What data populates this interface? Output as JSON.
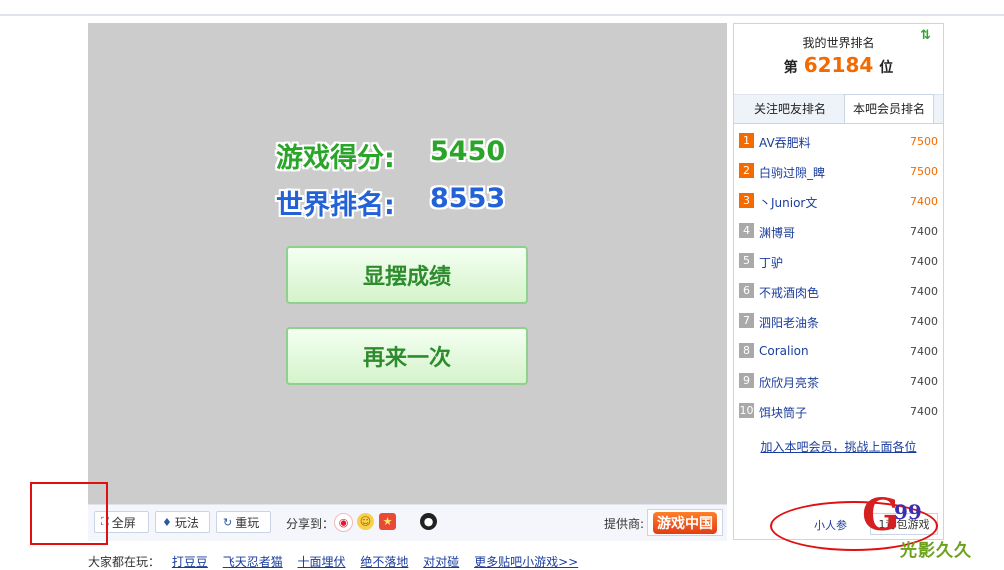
{
  "game": {
    "score_label": "游戏得分:",
    "score_value": "5450",
    "rank_label": "世界排名:",
    "rank_value": "8553",
    "show_button": "显摆成绩",
    "again_button": "再来一次"
  },
  "toolbar": {
    "fullscreen": "全屏",
    "howto": "玩法",
    "replay": "重玩",
    "share_label": "分享到：",
    "provider_label": "提供商:",
    "provider_name": "游戏中国"
  },
  "bottom": {
    "label": "大家都在玩：",
    "links": [
      "打豆豆",
      "飞天忍者猫",
      "十面埋伏",
      "绝不落地",
      "对对碰",
      "更多贴吧小游戏>>"
    ]
  },
  "panel": {
    "title": "我的世界排名",
    "rank_prefix": "第",
    "rank_value": "62184",
    "rank_suffix": "位",
    "tabs": [
      "关注吧友排名",
      "本吧会员排名"
    ],
    "items": [
      {
        "no": "1",
        "name": "AV吞肥料",
        "score": "7500"
      },
      {
        "no": "2",
        "name": "白驹过隙_睥",
        "score": "7500"
      },
      {
        "no": "3",
        "name": "丶Junior文",
        "score": "7400"
      },
      {
        "no": "4",
        "name": "渊博哥",
        "score": "7400"
      },
      {
        "no": "5",
        "name": "丁驴",
        "score": "7400"
      },
      {
        "no": "6",
        "name": "不戒酒肉色",
        "score": "7400"
      },
      {
        "no": "7",
        "name": "泗阳老油条",
        "score": "7400"
      },
      {
        "no": "8",
        "name": "Coralion",
        "score": "7400"
      },
      {
        "no": "9",
        "name": "欣欣月亮茶",
        "score": "7400"
      },
      {
        "no": "10",
        "name": "饵块筒子",
        "score": "7400"
      }
    ],
    "join_link": "加入本吧会员，挑战上面各位",
    "user_label": "小人参",
    "more_games": "1背包游戏"
  },
  "watermark": {
    "number": "99",
    "letter": "G",
    "text": "光影久久"
  },
  "colors": {
    "accent_orange": "#f26a00",
    "score_green": "#2aa52a",
    "rank_blue": "#2262d6",
    "link_blue": "#1a3c9c"
  }
}
